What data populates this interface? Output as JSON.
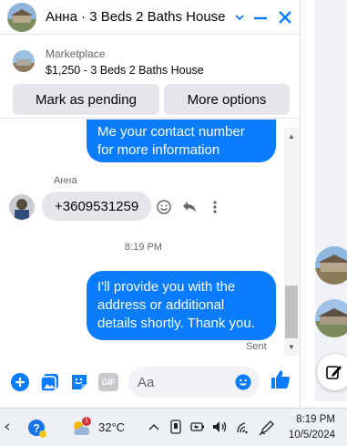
{
  "chat": {
    "title": "Анна · 3 Beds 2 Baths House",
    "listing": {
      "label": "Marketplace",
      "title": "$1,250 - 3 Beds 2 Baths House"
    },
    "buttons": {
      "mark_pending": "Mark as pending",
      "more_options": "More options"
    },
    "messages": {
      "outgoing_1_line1": "Me your contact number",
      "outgoing_1_line2": "for more information",
      "sender_name": "Анна",
      "incoming_1": "+3609531259",
      "timestamp": "8:19 PM",
      "outgoing_2_line1": "I'll provide you with the",
      "outgoing_2_line2": "address or additional",
      "outgoing_2_line3": "details shortly. Thank you.",
      "status": "Sent"
    },
    "composer": {
      "placeholder": "Aa",
      "gif_label": "GIF"
    }
  },
  "taskbar": {
    "weather_temp": "32°C",
    "weather_badge": "1",
    "time": "8:19 PM",
    "date": "10/5/2024"
  },
  "colors": {
    "accent": "#0a7cff",
    "bubble_in": "#e4e6eb",
    "button_bg": "#e4e6eb"
  }
}
